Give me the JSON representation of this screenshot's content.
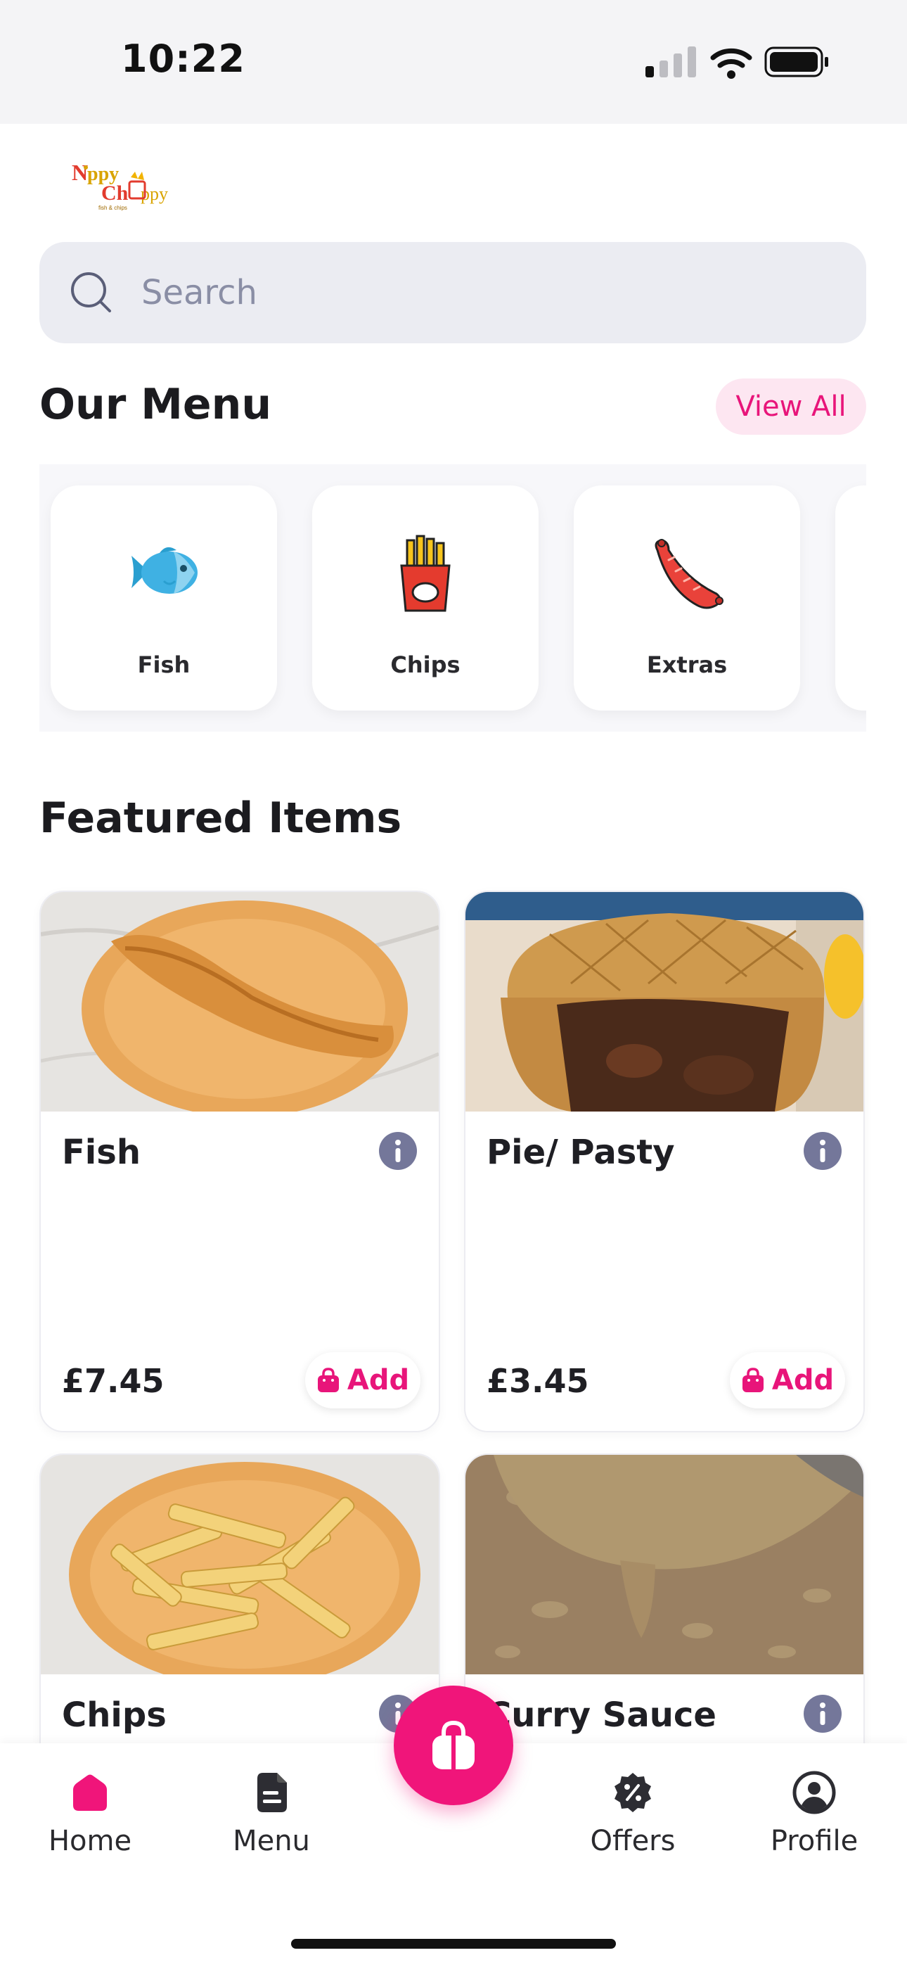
{
  "status_bar": {
    "time": "10:22"
  },
  "header": {
    "logo_alt": "Nippy Chippy"
  },
  "search": {
    "placeholder": "Search",
    "icon": "search-icon"
  },
  "menu_section": {
    "title": "Our Menu",
    "view_all": "View All",
    "categories": [
      {
        "label": "Fish",
        "icon": "fish-icon"
      },
      {
        "label": "Chips",
        "icon": "chips-icon"
      },
      {
        "label": "Extras",
        "icon": "sausage-icon"
      }
    ]
  },
  "featured": {
    "title": "Featured Items",
    "add_label": "Add",
    "items": [
      {
        "name": "Fish",
        "price": "£7.45"
      },
      {
        "name": "Pie/ Pasty",
        "price": "£3.45"
      },
      {
        "name": "Chips"
      },
      {
        "name": "Curry Sauce"
      }
    ]
  },
  "bottom_nav": {
    "items": [
      {
        "label": "Home",
        "icon": "home-icon",
        "active": true
      },
      {
        "label": "Menu",
        "icon": "menu-icon",
        "active": false
      },
      {
        "label": "Offers",
        "icon": "offers-icon",
        "active": false
      },
      {
        "label": "Profile",
        "icon": "profile-icon",
        "active": false
      }
    ],
    "cart_icon": "shopping-bag-icon"
  },
  "colors": {
    "accent": "#e8157a",
    "search_bg": "#ebecf2",
    "info": "#74779a"
  }
}
